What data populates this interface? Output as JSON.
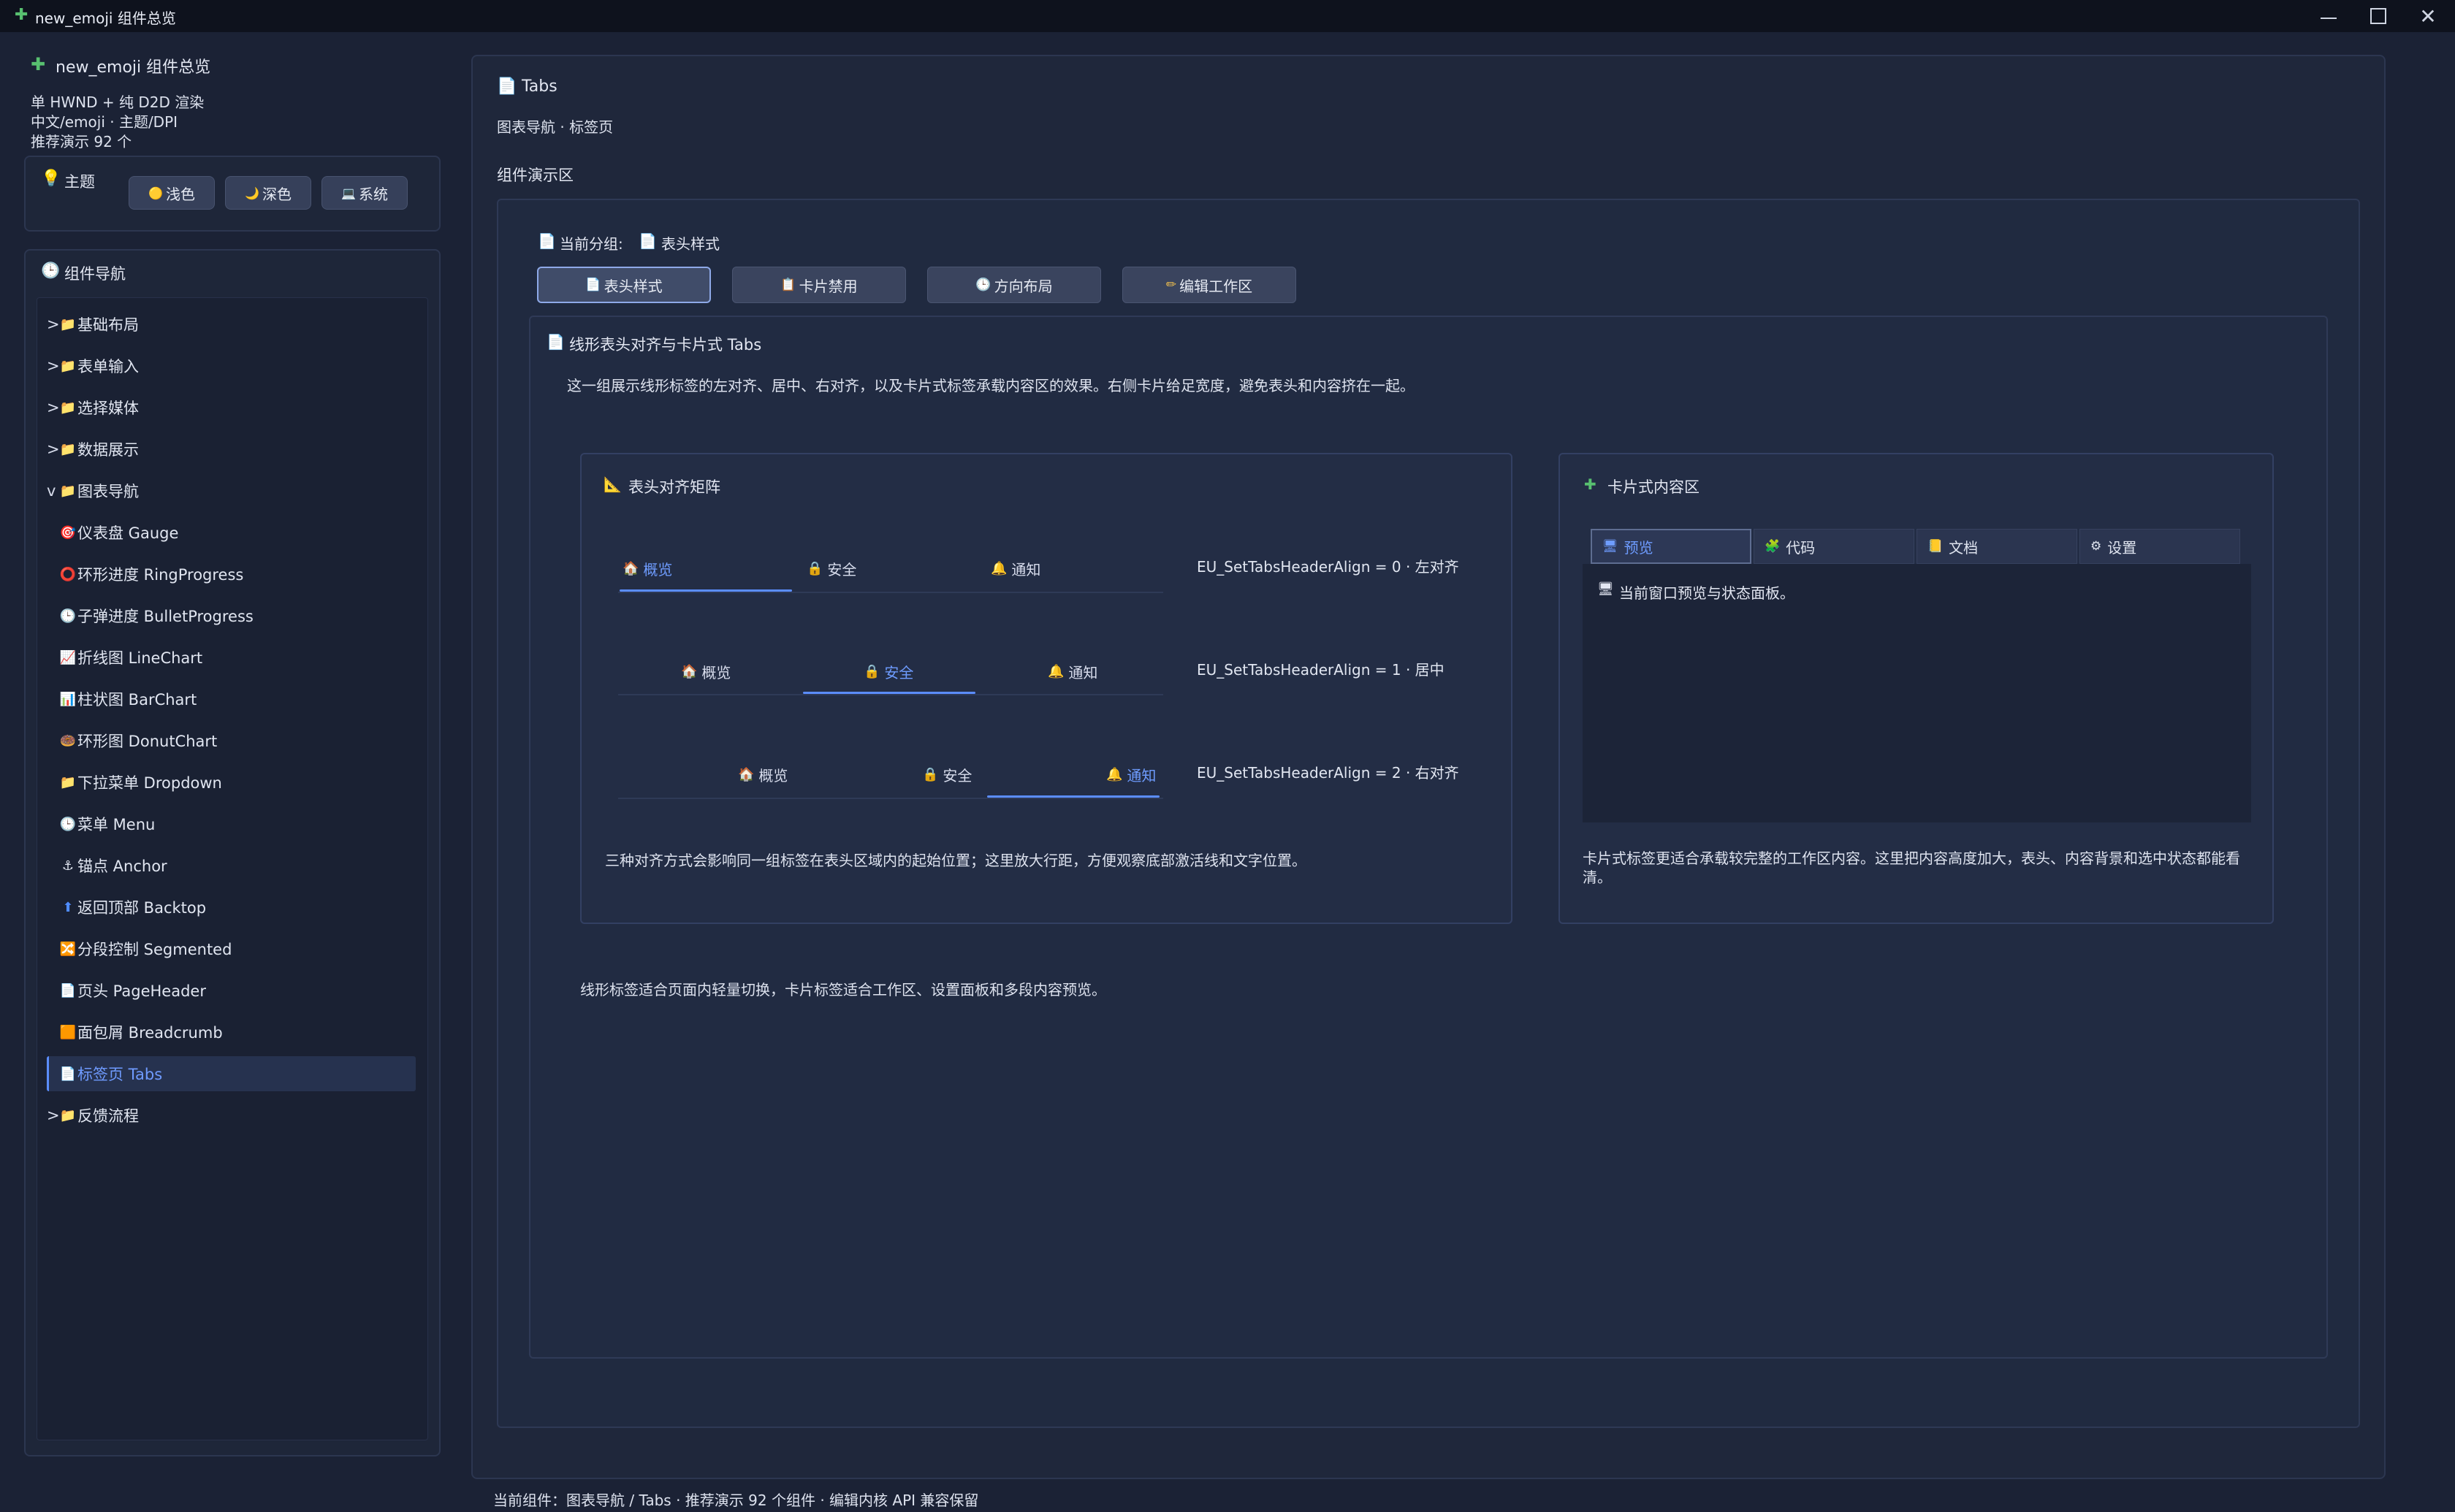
{
  "window": {
    "title": "new_emoji 组件总览",
    "app_icon": "puzzle-icon",
    "controls": [
      "minimize",
      "maximize",
      "close"
    ]
  },
  "app": {
    "title": "new_emoji 组件总览",
    "lines": [
      "单 HWND + 纯 D2D 渲染",
      "中文/emoji · 主题/DPI",
      "推荐演示 92 个"
    ]
  },
  "theme": {
    "label": "主题",
    "buttons": [
      {
        "icon": "🟡",
        "label": "浅色"
      },
      {
        "icon": "🌙",
        "label": "深色"
      },
      {
        "icon": "💻",
        "label": "系统"
      }
    ]
  },
  "nav": {
    "label": "组件导航",
    "groups_before": [
      {
        "caret": ">",
        "label": "基础布局"
      },
      {
        "caret": ">",
        "label": "表单输入"
      },
      {
        "caret": ">",
        "label": "选择媒体"
      },
      {
        "caret": ">",
        "label": "数据展示"
      }
    ],
    "open_group": {
      "caret": "v",
      "label": "图表导航"
    },
    "children": [
      {
        "icon": "🎯",
        "label": "仪表盘 Gauge"
      },
      {
        "icon": "⭕",
        "label": "环形进度 RingProgress"
      },
      {
        "icon": "🕒",
        "label": "子弹进度 BulletProgress"
      },
      {
        "icon": "📈",
        "label": "折线图 LineChart"
      },
      {
        "icon": "📊",
        "label": "柱状图 BarChart"
      },
      {
        "icon": "🍩",
        "label": "环形图 DonutChart"
      },
      {
        "icon": "📁",
        "label": "下拉菜单 Dropdown"
      },
      {
        "icon": "🕒",
        "label": "菜单 Menu"
      },
      {
        "icon": "⚓",
        "label": "锚点 Anchor"
      },
      {
        "icon": "⬆",
        "label": "返回顶部 Backtop"
      },
      {
        "icon": "🔀",
        "label": "分段控制 Segmented"
      },
      {
        "icon": "📄",
        "label": "页头 PageHeader"
      },
      {
        "icon": "🟧",
        "label": "面包屑 Breadcrumb"
      },
      {
        "icon": "📄",
        "label": "标签页 Tabs"
      }
    ],
    "groups_after": [
      {
        "caret": ">",
        "label": "反馈流程"
      }
    ],
    "active_index": 13
  },
  "page": {
    "title": "Tabs",
    "subtitle": "图表导航 · 标签页",
    "demo_area_label": "组件演示区",
    "current_group_label": "当前分组:",
    "current_group_value": "表头样式",
    "segments": [
      {
        "icon": "📄",
        "label": "表头样式"
      },
      {
        "icon": "📋",
        "label": "卡片禁用"
      },
      {
        "icon": "🕒",
        "label": "方向布局"
      },
      {
        "icon": "✏",
        "label": "编辑工作区"
      }
    ],
    "active_segment": 0,
    "section_title": "线形表头对齐与卡片式 Tabs",
    "section_desc": "这一组展示线形标签的左对齐、居中、右对齐，以及卡片式标签承载内容区的效果。右侧卡片给足宽度，避免表头和内容挤在一起。",
    "align_card": {
      "title": "表头对齐矩阵",
      "tabs": [
        {
          "icon": "🏠",
          "label": "概览"
        },
        {
          "icon": "🔒",
          "label": "安全"
        },
        {
          "icon": "🔔",
          "label": "通知"
        }
      ],
      "rows": [
        {
          "label": "EU_SetTabsHeaderAlign = 0 · 左对齐",
          "active": 0
        },
        {
          "label": "EU_SetTabsHeaderAlign = 1 · 居中",
          "active": 1
        },
        {
          "label": "EU_SetTabsHeaderAlign = 2 · 右对齐",
          "active": 2
        }
      ],
      "note": "三种对齐方式会影响同一组标签在表头区域内的起始位置；这里放大行距，方便观察底部激活线和文字位置。"
    },
    "card_tabs": {
      "title": "卡片式内容区",
      "tabs": [
        {
          "icon": "🖥",
          "label": "预览"
        },
        {
          "icon": "🧩",
          "label": "代码"
        },
        {
          "icon": "📒",
          "label": "文档"
        },
        {
          "icon": "⚙",
          "label": "设置"
        }
      ],
      "active": 0,
      "content": "当前窗口预览与状态面板。",
      "note": "卡片式标签更适合承载较完整的工作区内容。这里把内容高度加大，表头、内容背景和选中状态都能看清。"
    },
    "bottom_note": "线形标签适合页面内轻量切换，卡片标签适合工作区、设置面板和多段内容预览。"
  },
  "status": "当前组件：图表导航 / Tabs · 推荐演示 92 个组件 · 编辑内核 API 兼容保留",
  "colors": {
    "background": "#1b2235",
    "accent": "#5b8dff",
    "titlebar": "#0e121d"
  }
}
